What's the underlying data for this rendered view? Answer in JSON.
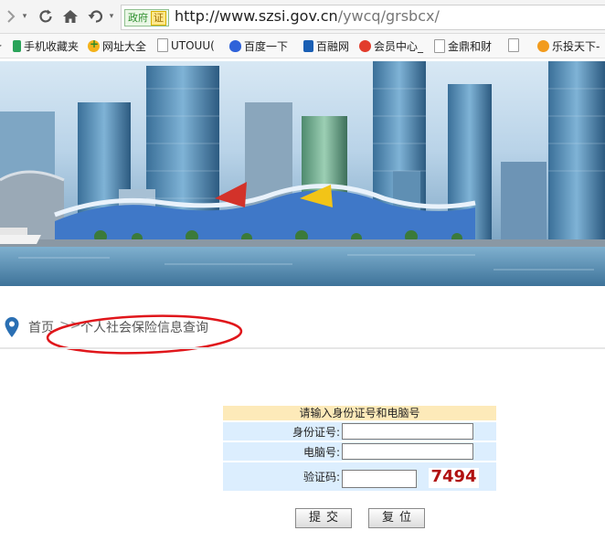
{
  "browser": {
    "gov_label": "政府",
    "gov_cert": "证",
    "url_host": "http://www.szsi.gov.cn",
    "url_path": "/ywcq/grsbcx/"
  },
  "bookmarks": [
    {
      "label": "手机收藏夹",
      "color": "#2aa35a"
    },
    {
      "label": "网址大全",
      "color": "#f3b21b"
    },
    {
      "label": "UTOUU(",
      "color": "#9a9a9a"
    },
    {
      "label": "百度一下",
      "color": "#2f62d9"
    },
    {
      "label": "百融网",
      "color": "#1a5fb4"
    },
    {
      "label": "会员中心_",
      "color": "#e23c2c"
    },
    {
      "label": "金鼎和财",
      "color": "#9a9a9a"
    },
    {
      "label": "",
      "color": "#9a9a9a"
    },
    {
      "label": "乐投天下-",
      "color": "#f29b1d"
    }
  ],
  "breadcrumb": {
    "home": "首页",
    "separator": ">>",
    "current": "个人社会保险信息查询"
  },
  "form": {
    "heading": "请输入身份证号和电脑号",
    "id_label": "身份证号:",
    "id_value": "",
    "computer_label": "电脑号:",
    "computer_value": "",
    "captcha_label": "验证码:",
    "captcha_value": "",
    "captcha_text": "7494",
    "submit_label": "提交",
    "reset_label": "复位"
  },
  "colors": {
    "highlight_circle": "#e0161b",
    "pin": "#2a6fb3",
    "form_header_bg": "#fdeab9",
    "form_row_bg": "#dceefe"
  }
}
